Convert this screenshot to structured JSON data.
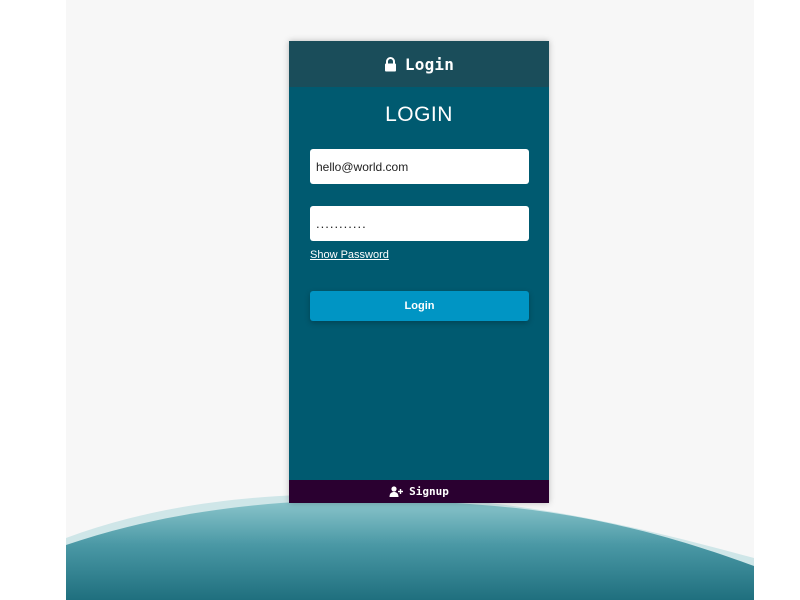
{
  "header": {
    "icon": "lock-icon",
    "title": "Login"
  },
  "form": {
    "heading": "LOGIN",
    "email_value": "hello@world.com",
    "password_value": "...........",
    "show_password_label": "Show Password",
    "submit_label": "Login"
  },
  "footer": {
    "icon": "user-plus-icon",
    "signup_label": "Signup"
  },
  "colors": {
    "panel_bg": "#005a70",
    "header_bg": "#1a4d5a",
    "footer_bg": "#2a0030",
    "button_bg": "#0095c4",
    "page_bg": "#f7f7f7",
    "wave_light": "#8cc6cc",
    "wave_dark": "#1f6f7e"
  }
}
